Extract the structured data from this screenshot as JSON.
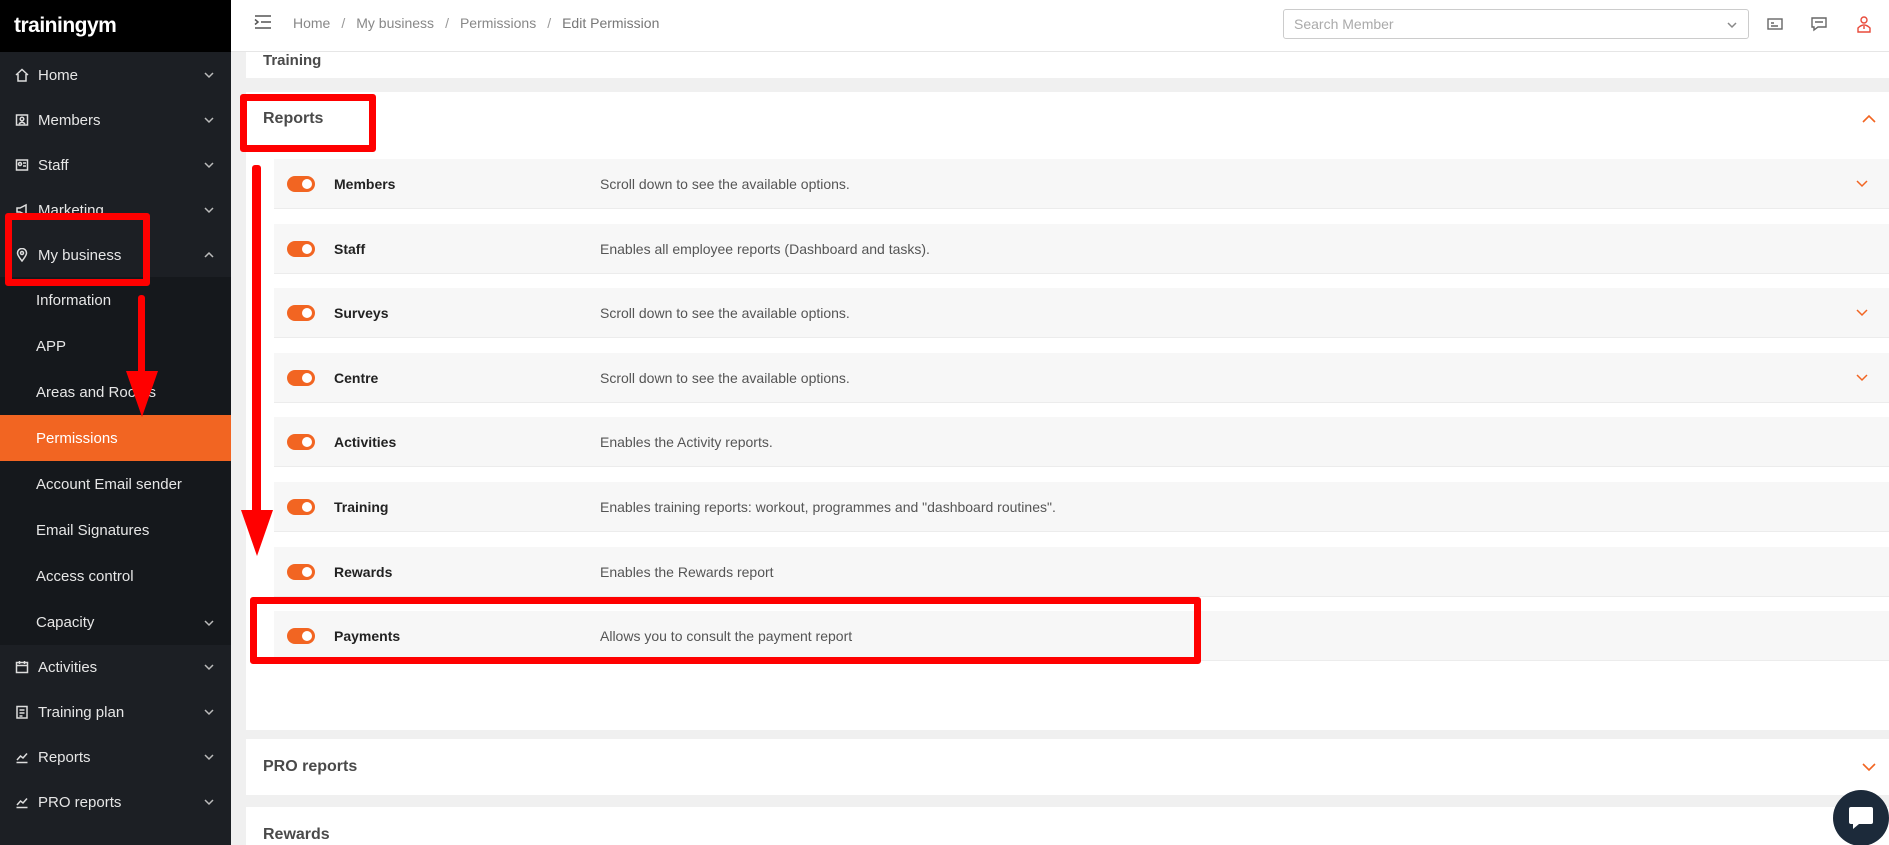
{
  "app": {
    "logo": "trainingym"
  },
  "sidebar": {
    "items": [
      {
        "label": "Home"
      },
      {
        "label": "Members"
      },
      {
        "label": "Staff"
      },
      {
        "label": "Marketing"
      },
      {
        "label": "My business"
      }
    ],
    "sub_items": [
      {
        "label": "Information"
      },
      {
        "label": "APP"
      },
      {
        "label": "Areas and Rooms"
      },
      {
        "label": "Permissions"
      },
      {
        "label": "Account Email sender"
      },
      {
        "label": "Email Signatures"
      },
      {
        "label": "Access control"
      },
      {
        "label": "Capacity"
      }
    ],
    "bottom_items": [
      {
        "label": "Activities"
      },
      {
        "label": "Training plan"
      },
      {
        "label": "Reports"
      },
      {
        "label": "PRO reports"
      }
    ]
  },
  "header": {
    "breadcrumb": [
      "Home",
      "My business",
      "Permissions",
      "Edit Permission"
    ],
    "breadcrumb_sep": "/",
    "search_placeholder": "Search Member"
  },
  "main": {
    "top_section": {
      "title": "Training"
    },
    "reports_section": {
      "title": "Reports",
      "rows": [
        {
          "name": "Members",
          "desc": "Scroll down to see the available options.",
          "enabled": true,
          "expandable": true
        },
        {
          "name": "Staff",
          "desc": "Enables all employee reports (Dashboard and tasks).",
          "enabled": true,
          "expandable": false
        },
        {
          "name": "Surveys",
          "desc": "Scroll down to see the available options.",
          "enabled": true,
          "expandable": true
        },
        {
          "name": "Centre",
          "desc": "Scroll down to see the available options.",
          "enabled": true,
          "expandable": true
        },
        {
          "name": "Activities",
          "desc": "Enables the Activity reports.",
          "enabled": true,
          "expandable": false
        },
        {
          "name": "Training",
          "desc": "Enables training reports: workout, programmes and \"dashboard routines\".",
          "enabled": true,
          "expandable": false
        },
        {
          "name": "Rewards",
          "desc": "Enables the Rewards report",
          "enabled": true,
          "expandable": false
        },
        {
          "name": "Payments",
          "desc": "Allows you to consult the payment report",
          "enabled": true,
          "expandable": false
        }
      ]
    },
    "pro_reports_section": {
      "title": "PRO reports"
    },
    "rewards_section": {
      "title": "Rewards"
    }
  },
  "colors": {
    "accent": "#f26522",
    "sidebar_bg": "#1c1f24",
    "annotation": "#ff0000"
  },
  "icons": [
    "home-icon",
    "members-icon",
    "staff-icon",
    "marketing-icon",
    "location-pin-icon",
    "calendar-icon",
    "clipboard-icon",
    "chart-icon",
    "menu-toggle-icon",
    "calendar-card-icon",
    "chat-bubble-icon",
    "user-alert-icon"
  ]
}
